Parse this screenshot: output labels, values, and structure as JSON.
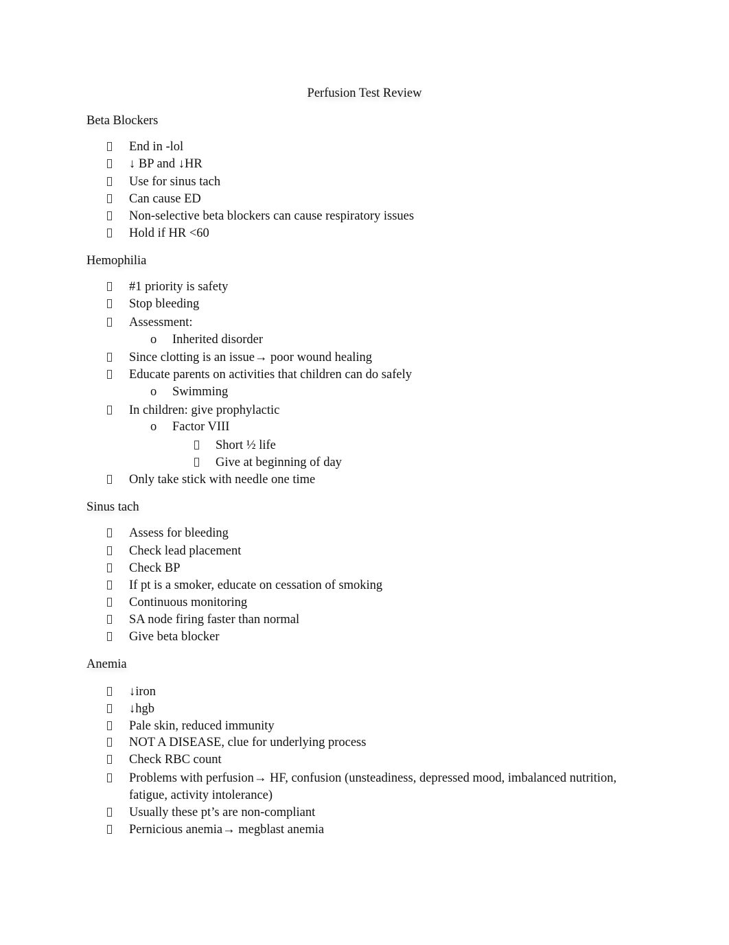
{
  "document": {
    "title": "Perfusion Test Review",
    "sections": [
      {
        "heading": "Beta Blockers",
        "items": [
          {
            "level": 1,
            "text": "End in -lol"
          },
          {
            "level": 1,
            "text": "↓ BP and ↓HR"
          },
          {
            "level": 1,
            "text": "Use for sinus tach"
          },
          {
            "level": 1,
            "text": "Can cause ED"
          },
          {
            "level": 1,
            "text": "Non-selective beta blockers can cause respiratory issues"
          },
          {
            "level": 1,
            "text": "Hold if HR <60"
          }
        ]
      },
      {
        "heading": "Hemophilia",
        "items": [
          {
            "level": 1,
            "text": "#1 priority is safety"
          },
          {
            "level": 1,
            "text": "Stop bleeding"
          },
          {
            "level": 1,
            "text": "Assessment:"
          },
          {
            "level": 2,
            "text": "Inherited disorder"
          },
          {
            "level": 1,
            "text": "Since clotting is an issue→ poor wound healing"
          },
          {
            "level": 1,
            "text": "Educate parents on activities that children can do safely"
          },
          {
            "level": 2,
            "text": "Swimming"
          },
          {
            "level": 1,
            "text": "In children: give prophylactic"
          },
          {
            "level": 2,
            "text": "Factor VIII"
          },
          {
            "level": 3,
            "text": "Short ½ life"
          },
          {
            "level": 3,
            "text": "Give at beginning of day"
          },
          {
            "level": 1,
            "text": "Only take stick with needle one time"
          }
        ]
      },
      {
        "heading": "Sinus tach",
        "items": [
          {
            "level": 1,
            "text": "Assess for bleeding"
          },
          {
            "level": 1,
            "text": "Check lead placement"
          },
          {
            "level": 1,
            "text": "Check BP"
          },
          {
            "level": 1,
            "text": "If pt is a smoker, educate on cessation of smoking"
          },
          {
            "level": 1,
            "text": "Continuous monitoring"
          },
          {
            "level": 1,
            "text": "SA node firing faster than normal"
          },
          {
            "level": 1,
            "text": "Give beta blocker"
          }
        ]
      },
      {
        "heading": "Anemia",
        "items": [
          {
            "level": 1,
            "text": "↓iron"
          },
          {
            "level": 1,
            "text": "↓hgb"
          },
          {
            "level": 1,
            "text": "Pale skin, reduced immunity"
          },
          {
            "level": 1,
            "text": "NOT A DISEASE, clue for underlying process"
          },
          {
            "level": 1,
            "text": "Check RBC count"
          },
          {
            "level": 1,
            "text": "Problems with perfusion→ HF, confusion (unsteadiness, depressed mood, imbalanced nutrition, fatigue, activity intolerance)"
          },
          {
            "level": 1,
            "text": "Usually these pt’s are non-compliant"
          },
          {
            "level": 1,
            "text": "Pernicious anemia→ megblast anemia"
          }
        ]
      }
    ],
    "sub_bullet_glyph": "o"
  }
}
